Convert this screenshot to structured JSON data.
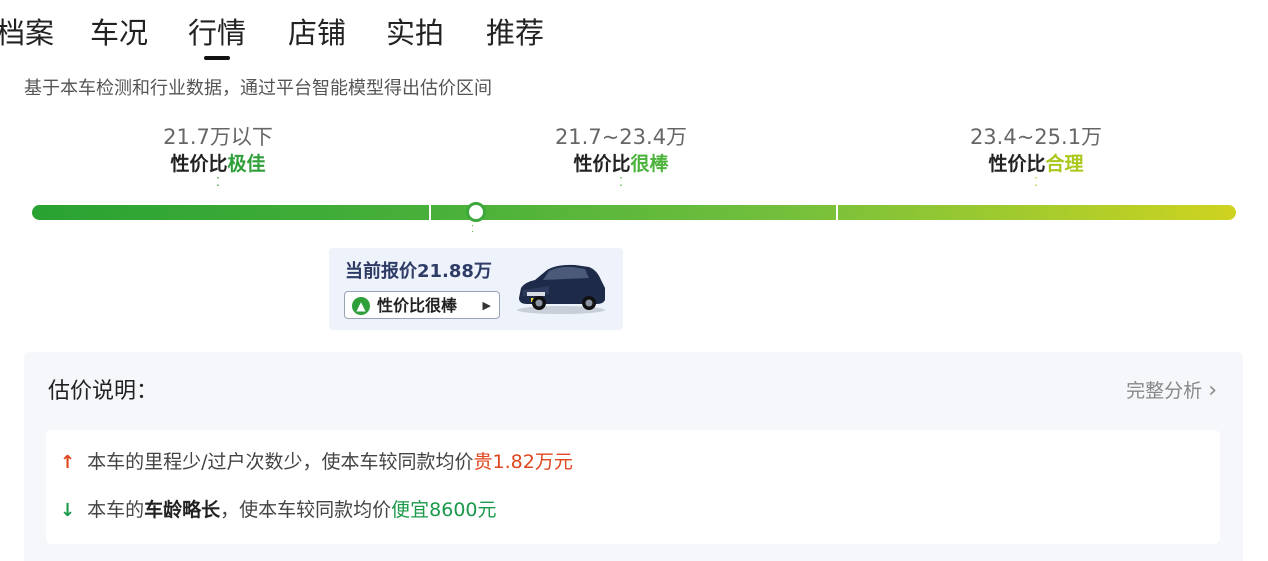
{
  "tabs": [
    {
      "label": "档案",
      "active": false
    },
    {
      "label": "车况",
      "active": false
    },
    {
      "label": "行情",
      "active": true
    },
    {
      "label": "店铺",
      "active": false
    },
    {
      "label": "实拍",
      "active": false
    },
    {
      "label": "推荐",
      "active": false
    }
  ],
  "subtitle": "基于本车检测和行业数据，通过平台智能模型得出估价区间",
  "ranges": [
    {
      "price": "21.7万以下",
      "label_prefix": "性价比",
      "label_grade": "极佳",
      "grade_color": "#2f9f3a"
    },
    {
      "price": "21.7~23.4万",
      "label_prefix": "性价比",
      "label_grade": "很棒",
      "grade_color": "#4cb33c"
    },
    {
      "price": "23.4~25.1万",
      "label_prefix": "性价比",
      "label_grade": "合理",
      "grade_color": "#a8c81c"
    }
  ],
  "current": {
    "price_text": "当前报价21.88万",
    "grade_text": "性价比很棒",
    "up_icon": "arrow-up-circle-icon",
    "chevron_icon": "triangle-right-icon",
    "position_fraction": 0.37
  },
  "explain": {
    "title": "估价说明：",
    "link_label": "完整分析",
    "reasons": [
      {
        "icon": "arrow-up-icon",
        "icon_color": "#e0461f",
        "prefix": "本车的",
        "factor": "里程少/过户次数少",
        "middle": "，使本车较同款均价",
        "result": "贵1.82万元",
        "result_color": "#e0461f"
      },
      {
        "icon": "arrow-down-icon",
        "icon_color": "#1a9a4a",
        "prefix": "本车的",
        "factor": "车龄略长",
        "middle": "，使本车较同款均价",
        "result": "便宜8600元",
        "result_color": "#1a9a4a"
      }
    ]
  },
  "colors": {
    "bar_start": "#29a232",
    "bar_end": "#cfd31f",
    "card_bg": "#eef3fb",
    "panel_bg": "#f5f7fa"
  }
}
